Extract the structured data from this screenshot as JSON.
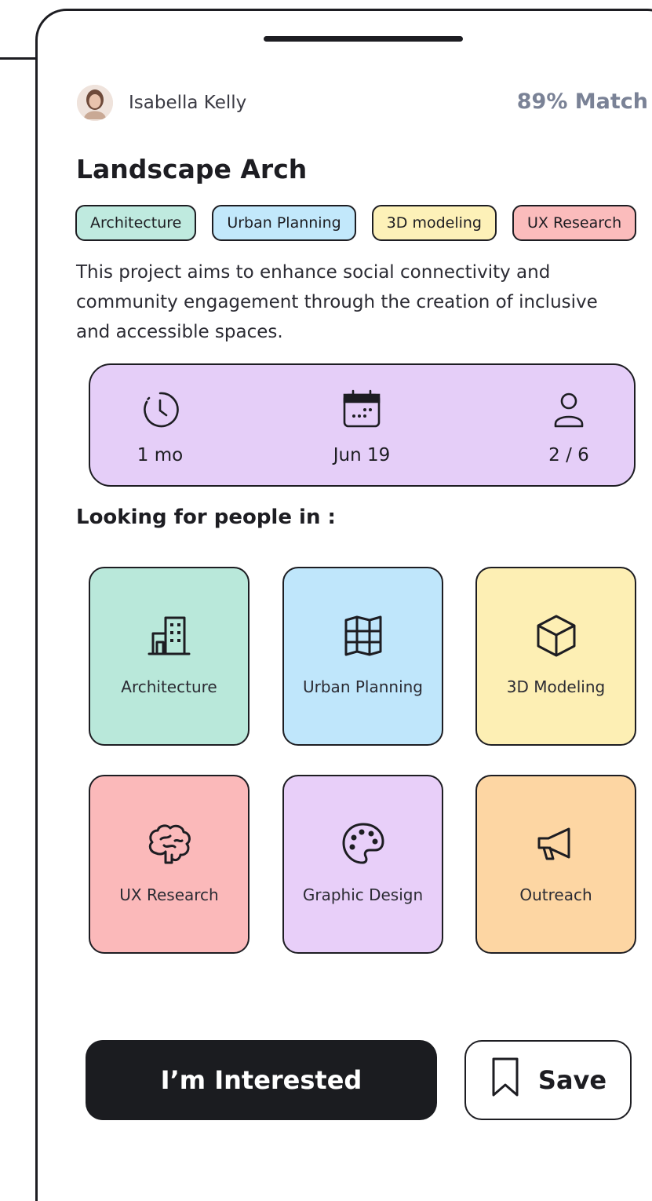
{
  "owner": {
    "name": "Isabella Kelly",
    "avatar": "avatar"
  },
  "match": "89% Match",
  "project": {
    "title": "Landscape Arch",
    "tags": [
      {
        "label": "Architecture",
        "color": "#bfeadf"
      },
      {
        "label": "Urban Planning",
        "color": "#c2e8fb"
      },
      {
        "label": "3D modeling",
        "color": "#fdf1b8"
      },
      {
        "label": "UX Research",
        "color": "#fbbcbc"
      }
    ],
    "description": "This project aims to enhance social connectivity and community engagement through the creation of inclusive and accessible spaces."
  },
  "stats": {
    "background": "#e5cef8",
    "duration": {
      "icon": "clock-icon",
      "value": "1 mo"
    },
    "date": {
      "icon": "calendar-icon",
      "value": "Jun 19"
    },
    "members": {
      "icon": "person-icon",
      "value": "2 / 6"
    }
  },
  "looking_for": {
    "heading": "Looking for people in :",
    "items": [
      {
        "label": "Architecture",
        "icon": "building-icon",
        "color": "#b9e8da"
      },
      {
        "label": "Urban Planning",
        "icon": "map-icon",
        "color": "#bfe6fb"
      },
      {
        "label": "3D Modeling",
        "icon": "cube-icon",
        "color": "#fdefb4"
      },
      {
        "label": "UX Research",
        "icon": "brain-icon",
        "color": "#fbb9ba"
      },
      {
        "label": "Graphic Design",
        "icon": "palette-icon",
        "color": "#e8cff9"
      },
      {
        "label": "Outreach",
        "icon": "megaphone-icon",
        "color": "#fdd6a3"
      }
    ]
  },
  "actions": {
    "interested_label": "I’m Interested",
    "save_label": "Save",
    "save_icon": "bookmark-icon"
  }
}
